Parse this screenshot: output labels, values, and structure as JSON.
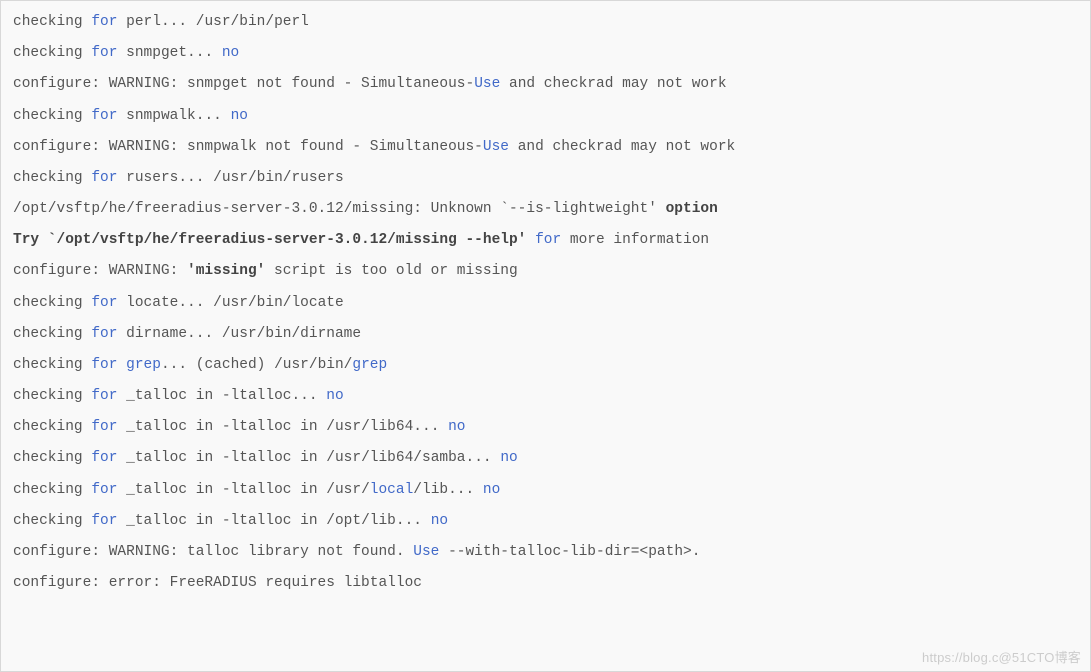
{
  "lines": [
    {
      "segs": [
        {
          "t": "checking "
        },
        {
          "t": "for",
          "c": "kw"
        },
        {
          "t": " perl... /usr/bin/perl"
        }
      ]
    },
    {
      "segs": [
        {
          "t": "checking "
        },
        {
          "t": "for",
          "c": "kw"
        },
        {
          "t": " snmpget... "
        },
        {
          "t": "no",
          "c": "kw"
        }
      ]
    },
    {
      "segs": [
        {
          "t": "configure: WARNING: snmpget not found - Simultaneous-"
        },
        {
          "t": "Use",
          "c": "kw"
        },
        {
          "t": " and checkrad may not work"
        }
      ]
    },
    {
      "segs": [
        {
          "t": "checking "
        },
        {
          "t": "for",
          "c": "kw"
        },
        {
          "t": " snmpwalk... "
        },
        {
          "t": "no",
          "c": "kw"
        }
      ]
    },
    {
      "segs": [
        {
          "t": "configure: WARNING: snmpwalk not found - Simultaneous-"
        },
        {
          "t": "Use",
          "c": "kw"
        },
        {
          "t": " and checkrad may not work"
        }
      ]
    },
    {
      "segs": [
        {
          "t": "checking "
        },
        {
          "t": "for",
          "c": "kw"
        },
        {
          "t": " rusers... /usr/bin/rusers"
        }
      ]
    },
    {
      "segs": [
        {
          "t": "/opt/vsftp/he/freeradius-server-3.0.12/missing: Unknown `--is-lightweight' "
        },
        {
          "t": "option",
          "c": "bold"
        }
      ]
    },
    {
      "segs": [
        {
          "t": "Try `/opt/vsftp/he/freeradius-server-3.0.12/missing --help'",
          "c": "bold"
        },
        {
          "t": " "
        },
        {
          "t": "for",
          "c": "kw"
        },
        {
          "t": " more information"
        }
      ]
    },
    {
      "segs": [
        {
          "t": "configure: WARNING: "
        },
        {
          "t": "'missing'",
          "c": "bold"
        },
        {
          "t": " script is too old or missing"
        }
      ]
    },
    {
      "segs": [
        {
          "t": "checking "
        },
        {
          "t": "for",
          "c": "kw"
        },
        {
          "t": " locate... /usr/bin/locate"
        }
      ]
    },
    {
      "segs": [
        {
          "t": "checking "
        },
        {
          "t": "for",
          "c": "kw"
        },
        {
          "t": " dirname... /usr/bin/dirname"
        }
      ]
    },
    {
      "segs": [
        {
          "t": "checking "
        },
        {
          "t": "for",
          "c": "kw"
        },
        {
          "t": " "
        },
        {
          "t": "grep",
          "c": "kw"
        },
        {
          "t": "... (cached) /usr/bin/"
        },
        {
          "t": "grep",
          "c": "kw"
        }
      ]
    },
    {
      "segs": [
        {
          "t": "checking "
        },
        {
          "t": "for",
          "c": "kw"
        },
        {
          "t": " _talloc in -ltalloc... "
        },
        {
          "t": "no",
          "c": "kw"
        }
      ]
    },
    {
      "segs": [
        {
          "t": "checking "
        },
        {
          "t": "for",
          "c": "kw"
        },
        {
          "t": " _talloc in -ltalloc in /usr/lib64... "
        },
        {
          "t": "no",
          "c": "kw"
        }
      ]
    },
    {
      "segs": [
        {
          "t": "checking "
        },
        {
          "t": "for",
          "c": "kw"
        },
        {
          "t": " _talloc in -ltalloc in /usr/lib64/samba... "
        },
        {
          "t": "no",
          "c": "kw"
        }
      ]
    },
    {
      "segs": [
        {
          "t": "checking "
        },
        {
          "t": "for",
          "c": "kw"
        },
        {
          "t": " _talloc in -ltalloc in /usr/"
        },
        {
          "t": "local",
          "c": "kw"
        },
        {
          "t": "/lib... "
        },
        {
          "t": "no",
          "c": "kw"
        }
      ]
    },
    {
      "segs": [
        {
          "t": "checking "
        },
        {
          "t": "for",
          "c": "kw"
        },
        {
          "t": " _talloc in -ltalloc in /opt/lib... "
        },
        {
          "t": "no",
          "c": "kw"
        }
      ]
    },
    {
      "segs": [
        {
          "t": "configure: WARNING: talloc library not found. "
        },
        {
          "t": "Use",
          "c": "kw"
        },
        {
          "t": " --with-talloc-lib-dir=<path>."
        }
      ]
    },
    {
      "segs": [
        {
          "t": "configure: error: FreeRADIUS requires libtalloc"
        }
      ]
    }
  ],
  "watermark": "https://blog.c@51CTO博客"
}
